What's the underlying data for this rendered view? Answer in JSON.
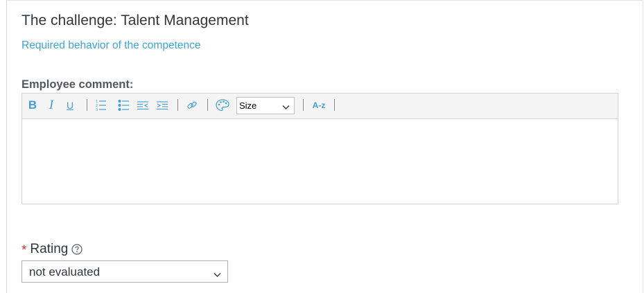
{
  "section": {
    "title": "The challenge: Talent Management",
    "link_text": "Required behavior of the competence"
  },
  "comment": {
    "label": "Employee comment:",
    "value": ""
  },
  "toolbar": {
    "bold_label": "B",
    "italic_label": "I",
    "underline_label": "U",
    "size_select_value": "Size",
    "case_label": "A-z",
    "icons": [
      "ordered-list-icon",
      "unordered-list-icon",
      "outdent-icon",
      "indent-icon",
      "link-icon",
      "palette-icon",
      "chevron-down-icon",
      "case-icon"
    ]
  },
  "rating": {
    "required_marker": "*",
    "label": "Rating",
    "selected_value": "not evaluated"
  },
  "colors": {
    "accent": "#3aa3d8",
    "required": "#d0362b",
    "text": "#32363a"
  }
}
